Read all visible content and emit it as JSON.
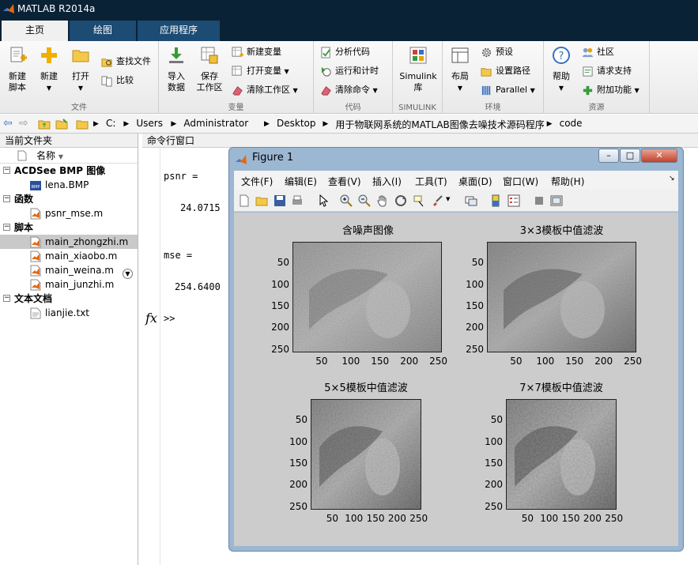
{
  "app": {
    "title": "MATLAB R2014a"
  },
  "tabs": [
    "主页",
    "绘图",
    "应用程序"
  ],
  "ribbon": {
    "new_script": "新建\n脚本",
    "new": "新建",
    "open": "打开",
    "find_files": "查找文件",
    "compare": "比较",
    "group_file": "文件",
    "import_data": "导入\n数据",
    "save_workspace": "保存\n工作区",
    "new_variable": "新建变量",
    "open_variable": "打开变量",
    "clear_workspace": "清除工作区",
    "group_variable": "变量",
    "analyze_code": "分析代码",
    "run_and_time": "运行和计时",
    "clear_commands": "清除命令",
    "group_code": "代码",
    "simulink_library": "Simulink\n库",
    "group_simulink": "SIMULINK",
    "layout": "布局",
    "preferences": "预设",
    "set_path": "设置路径",
    "parallel": "Parallel",
    "group_environment": "环境",
    "help": "帮助",
    "community": "社区",
    "request_support": "请求支持",
    "add_ons": "附加功能",
    "group_resources": "资源"
  },
  "address": {
    "parts": [
      "C:",
      "Users",
      "Administrator",
      "Desktop",
      "用于物联网系统的MATLAB图像去噪技术源码程序",
      "code"
    ]
  },
  "files": {
    "panel_title": "当前文件夹",
    "name_header": "名称",
    "sections": [
      {
        "label": "ACDSee BMP 图像",
        "items": [
          "lena.BMP"
        ]
      },
      {
        "label": "函数",
        "items": [
          "psnr_mse.m"
        ]
      },
      {
        "label": "脚本",
        "items": [
          "main_zhongzhi.m",
          "main_xiaobo.m",
          "main_weina.m",
          "main_junzhi.m"
        ]
      },
      {
        "label": "文本文档",
        "items": [
          "lianjie.txt"
        ]
      }
    ],
    "selected": "main_zhongzhi.m"
  },
  "command": {
    "title": "命令行窗口",
    "psnr_label": "psnr =",
    "psnr_value": "24.0715",
    "mse_label": "mse =",
    "mse_value": "254.6400",
    "fx": "fx",
    "prompt": ">>"
  },
  "figure": {
    "title": "Figure 1",
    "menu": [
      "文件(F)",
      "编辑(E)",
      "查看(V)",
      "插入(I)",
      "工具(T)",
      "桌面(D)",
      "窗口(W)",
      "帮助(H)"
    ],
    "plots": [
      {
        "title": "含噪声图像"
      },
      {
        "title": "3×3模板中值滤波"
      },
      {
        "title": "5×5模板中值滤波"
      },
      {
        "title": "7×7模板中值滤波"
      }
    ],
    "yticks": [
      "50",
      "100",
      "150",
      "200",
      "250"
    ],
    "xticks": [
      "50",
      "100",
      "150",
      "200",
      "250"
    ]
  }
}
